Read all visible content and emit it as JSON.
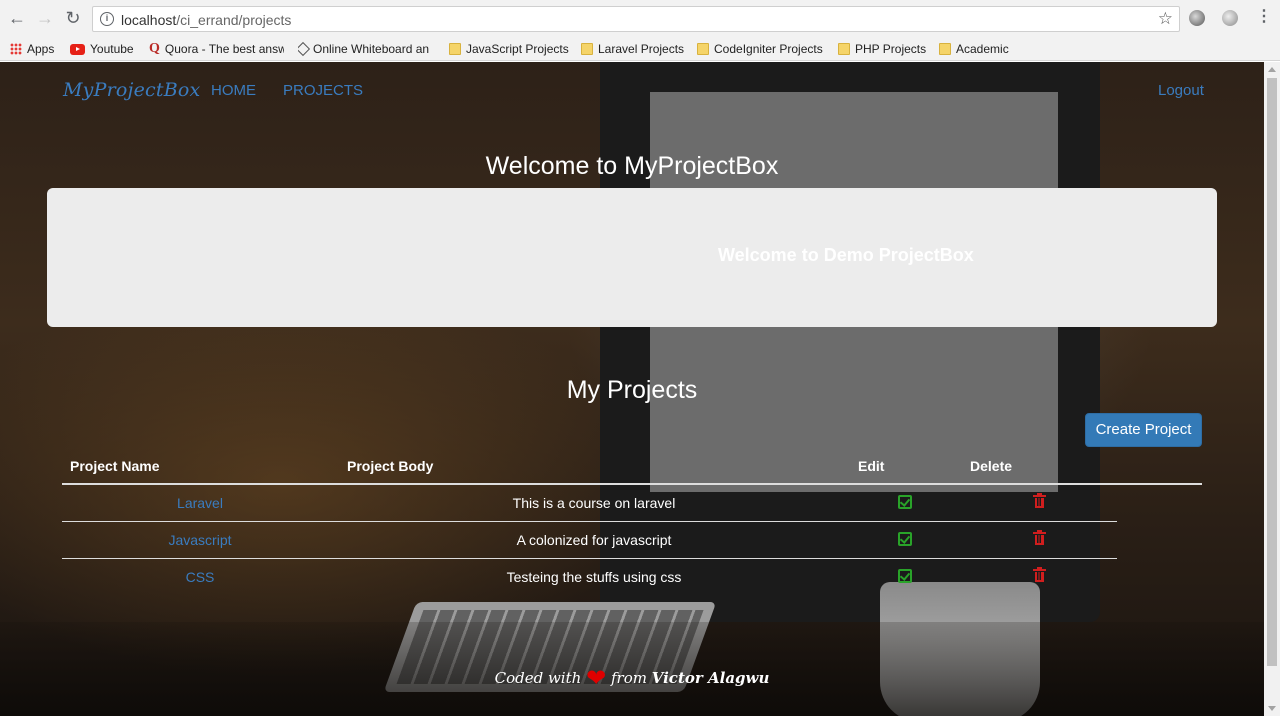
{
  "browser": {
    "url_host": "localhost",
    "url_path": "/ci_errand/projects",
    "bookmarks": [
      {
        "label": "Apps",
        "icon": "apps-grid-icon"
      },
      {
        "label": "Youtube",
        "icon": "youtube-icon"
      },
      {
        "label": "Quora - The best answ",
        "icon": "quora-icon"
      },
      {
        "label": "Online Whiteboard an",
        "icon": "whiteboard-icon"
      },
      {
        "label": "JavaScript Projects",
        "icon": "folder-icon"
      },
      {
        "label": "Laravel Projects",
        "icon": "folder-icon"
      },
      {
        "label": "CodeIgniter Projects",
        "icon": "folder-icon"
      },
      {
        "label": "PHP Projects",
        "icon": "folder-icon"
      },
      {
        "label": "Academic",
        "icon": "folder-icon"
      }
    ]
  },
  "navbar": {
    "brand": "MyProjectBox",
    "links": [
      "HOME",
      "PROJECTS"
    ],
    "logout": "Logout"
  },
  "welcome": {
    "title": "Welcome to MyProjectBox",
    "jumbotron_text": "Welcome to Demo ProjectBox"
  },
  "projects": {
    "title": "My Projects",
    "create_button": "Create Project",
    "headers": [
      "Project Name",
      "Project Body",
      "Edit",
      "Delete"
    ],
    "rows": [
      {
        "name": "Laravel",
        "body": "This is a course on laravel"
      },
      {
        "name": "Javascript",
        "body": "A colonized for javascript"
      },
      {
        "name": "CSS",
        "body": "Testeing the stuffs using css"
      }
    ]
  },
  "footer": {
    "prefix": "Coded with",
    "middle": "from",
    "author": "Victor Alagwu"
  },
  "colors": {
    "link": "#3a7cbf",
    "primary_button": "#337ab7",
    "edit": "#29a329",
    "delete": "#d11e1e"
  }
}
